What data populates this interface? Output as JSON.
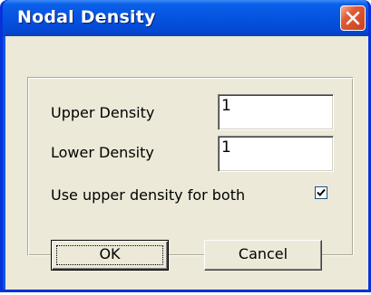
{
  "window": {
    "title": "Nodal Density"
  },
  "fields": {
    "upper_label": "Upper Density",
    "upper_value": "1",
    "lower_label": "Lower Density",
    "lower_value": "1"
  },
  "option": {
    "label": "Use upper density for both",
    "checked": true
  },
  "buttons": {
    "ok_label": "OK",
    "cancel_label": "Cancel"
  },
  "colors": {
    "titlebar": "#0553e0",
    "close_button": "#e05a36",
    "client_background": "#ece9d8"
  },
  "icons": {
    "close": "close-icon",
    "check": "checkmark-icon"
  }
}
